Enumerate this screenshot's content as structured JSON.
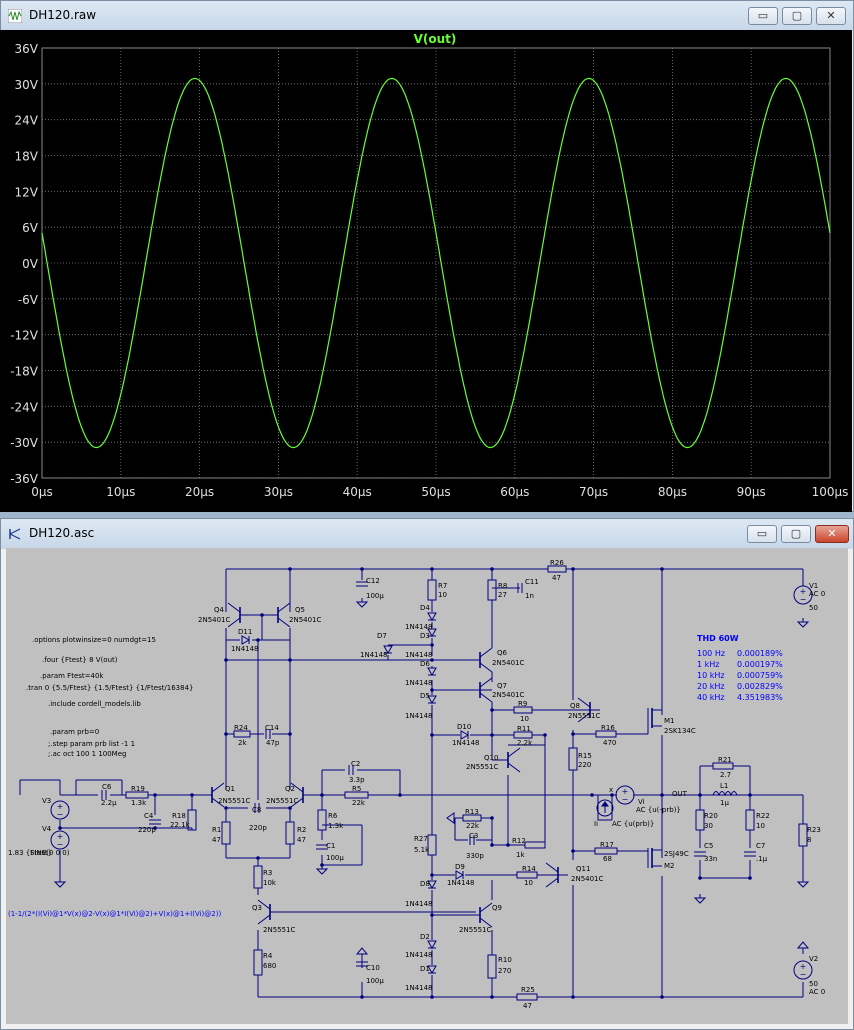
{
  "plot_window": {
    "title": "DH120.raw",
    "minimize": "▭",
    "maximize": "▢",
    "close": "✕"
  },
  "chart_data": {
    "type": "line",
    "title": "V(out)",
    "ylim": [
      -36,
      36
    ],
    "xlim": [
      0,
      100
    ],
    "y_ticks": [
      "36V",
      "30V",
      "24V",
      "18V",
      "12V",
      "6V",
      "0V",
      "-6V",
      "-12V",
      "-18V",
      "-24V",
      "-30V",
      "-36V"
    ],
    "x_ticks": [
      "0µs",
      "10µs",
      "20µs",
      "30µs",
      "40µs",
      "50µs",
      "60µs",
      "70µs",
      "80µs",
      "90µs",
      "100µs"
    ],
    "grid": true,
    "series": [
      {
        "name": "V(out)",
        "color": "#66ff33",
        "amplitude": 30.9,
        "frequency_khz": 40,
        "x_at_zero_crossing_us": 0.5,
        "x_peak_us": 19.4
      }
    ],
    "background": "#000000",
    "grid_color": "#7f7f7f"
  },
  "schematic_window": {
    "title": "DH120.asc",
    "minimize": "▭",
    "maximize": "▢",
    "close": "✕"
  },
  "schematic": {
    "directives": [
      ".options plotwinsize=0 numdgt=15",
      ".four {Ftest} 8 V(out)",
      ".param Ftest=40k",
      ".tran 0 {5.5/Ftest} {1.5/Ftest} {1/Ftest/16384}",
      ".include cordell_models.lib",
      ".param prb=0",
      ";.step param prb list -1 1",
      ";.ac oct 100 1 100Meg"
    ],
    "formula": "(1-1/(2*(I(Vi)@1*V(x)@2-V(x)@1*I(Vi)@2)+V(x)@1+I(Vi)@2))",
    "thd": {
      "title": "THD 60W",
      "rows": [
        {
          "freq": "100 Hz",
          "value": "0.000189%"
        },
        {
          "freq": "1 kHz",
          "value": "0.000197%"
        },
        {
          "freq": "10 kHz",
          "value": "0.000759%"
        },
        {
          "freq": "20 kHz",
          "value": "0.002829%"
        },
        {
          "freq": "40 kHz",
          "value": "4.351983%"
        }
      ]
    },
    "labels": {
      "Q4": "Q4",
      "Q4m": "2N5401C",
      "Q5": "Q5",
      "Q5m": "2N5401C",
      "D11": "D11",
      "D11m": "1N4148",
      "C12": "C12",
      "C12v": "100µ",
      "R7": "R7",
      "R7v": "10",
      "R8": "R8",
      "R8v": "27",
      "C11": "C11",
      "C11v": "1n",
      "R26": "R26",
      "R26v": "47",
      "V1": "V1",
      "V1a": "AC 0",
      "V1b": "50",
      "D4": "D4",
      "D4m": "1N4148",
      "D3": "D3",
      "D3m": "1N4148",
      "D7": "D7",
      "D7m": "1N4148",
      "D6": "D6",
      "D6m": "1N4148",
      "D5": "D5",
      "D5m": "1N4148",
      "Q6": "Q6",
      "Q6m": "2N5401C",
      "Q7": "Q7",
      "Q7m": "2N5401C",
      "R9": "R9",
      "R9v": "10",
      "Q8": "Q8",
      "Q8m": "2N5551C",
      "R16": "R16",
      "R16v": "470",
      "M1": "M1",
      "M1m": "2SK134C",
      "D10": "D10",
      "D10m": "1N4148",
      "R11": "R11",
      "R11v": "2.2k",
      "R24": "R24",
      "R24v": "2k",
      "C14": "C14",
      "C14v": "47p",
      "R15": "R15",
      "R15v": "220",
      "Q10": "Q10",
      "Q10m": "2N5551C",
      "C2": "C2",
      "C2v": "3.3p",
      "R5": "R5",
      "R5v": "22k",
      "R21": "R21",
      "R21v": "2.7",
      "L1": "L1",
      "L1v": "1µ",
      "OUT": "OUT",
      "x": "x",
      "Vi": "Vi",
      "Via": "AC {u(-prb)}",
      "Ii": "Ii",
      "Iia": "AC {u(prb)}",
      "V3": "V3",
      "V3a": "1.83 {Ftest}",
      "V4": "V4",
      "V4a": "SINE(0 0 0)",
      "C6": "C6",
      "C6v": "2.2µ",
      "R19": "R19",
      "R19v": "1.3k",
      "C4": "C4",
      "C4v": "220p",
      "R18": "R18",
      "R18v": "22.1k",
      "Q1": "Q1",
      "Q1m": "2N5551C",
      "Q2": "Q2",
      "Q2m": "2N5551C",
      "C8": "C8",
      "C8v": "220p",
      "R1": "R1",
      "R1v": "47",
      "R2": "R2",
      "R2v": "47",
      "R6": "R6",
      "R6v": "1.3k",
      "C1": "C1",
      "C1v": "100µ",
      "R13": "R13",
      "R13v": "22k",
      "C3": "C3",
      "C3v": "330p",
      "R12": "R12",
      "R12v": "1k",
      "R27": "R27",
      "R27v": "5.1k",
      "R17": "R17",
      "R17v": "68",
      "M2": "M2",
      "M2m": "2SJ49C",
      "R20": "R20",
      "R20v": "30",
      "R22": "R22",
      "R22v": "10",
      "C5": "C5",
      "C5v": "33n",
      "C7": "C7",
      "C7v": ".1µ",
      "R23": "R23",
      "R23v": "8",
      "D9": "D9",
      "D9m": "1N4148",
      "R14": "R14",
      "R14v": "10",
      "Q11": "Q11",
      "Q11m": "2N5401C",
      "R3": "R3",
      "R3v": "10k",
      "Q3": "Q3",
      "Q3m": "2N5551C",
      "D8": "D8",
      "D8m": "1N4148",
      "Q9": "Q9",
      "Q9m": "2N5551C",
      "D2": "D2",
      "D2m": "1N4148",
      "D1": "D1",
      "D1m": "1N4148",
      "R4": "R4",
      "R4v": "680",
      "C10": "C10",
      "C10v": "100µ",
      "R10": "R10",
      "R10v": "270",
      "R25": "R25",
      "R25v": "47",
      "V2": "V2",
      "V2a": "50",
      "V2b": "AC 0"
    }
  }
}
